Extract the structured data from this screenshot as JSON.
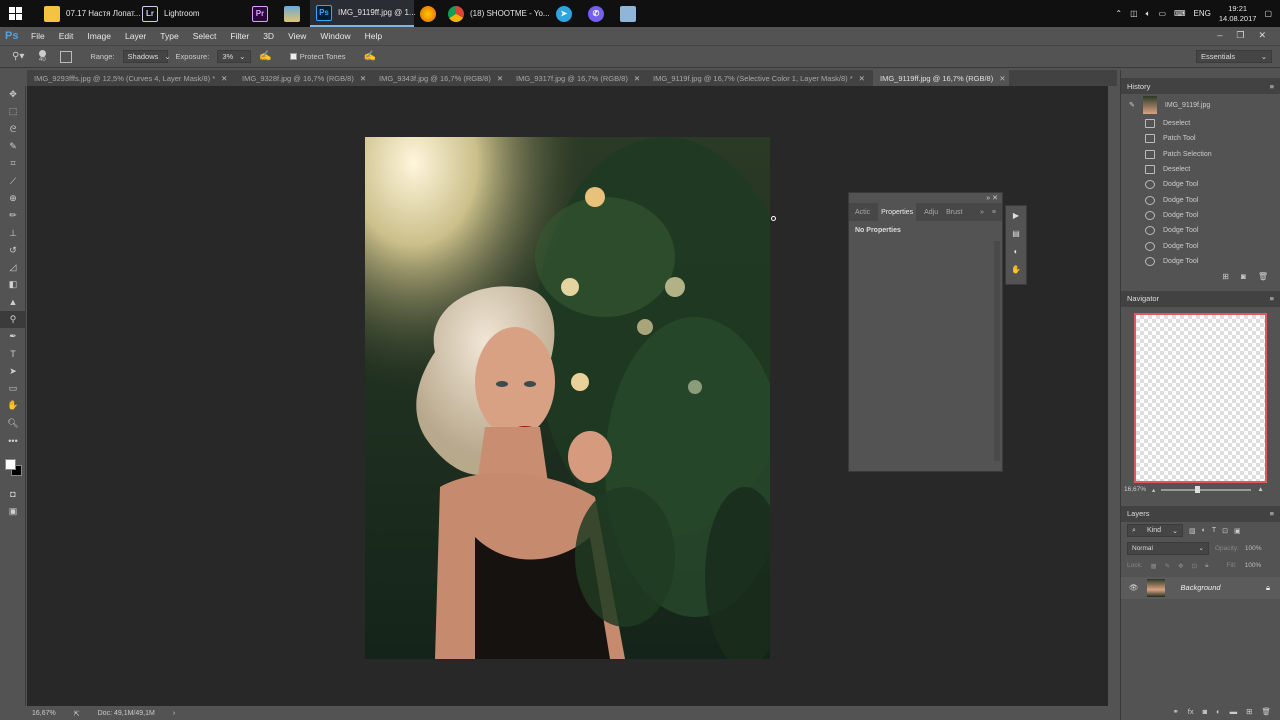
{
  "taskbar": {
    "items": [
      {
        "label": "07.17 Настя Лопат...",
        "icon": "folder-icon",
        "color": "#f5c342"
      },
      {
        "label": "Lightroom",
        "icon": "lightroom-icon",
        "color": "#31a8ff"
      },
      {
        "label": "",
        "icon": "premiere-icon",
        "color": "#9999ff"
      },
      {
        "label": "",
        "icon": "photos-icon",
        "color": "#5aa3d8"
      },
      {
        "label": "IMG_9119ff.jpg @ 1...",
        "icon": "photoshop-icon",
        "color": "#31a8ff"
      },
      {
        "label": "",
        "icon": "firefox-icon",
        "color": "#e66000"
      },
      {
        "label": "(18) SHOOTME - Yo...",
        "icon": "chrome-icon",
        "color": "#4caf50"
      },
      {
        "label": "",
        "icon": "telegram-icon",
        "color": "#2ca5e0"
      },
      {
        "label": "",
        "icon": "viber-icon",
        "color": "#7360f2"
      },
      {
        "label": "",
        "icon": "notepad-icon",
        "color": "#8fb6d8"
      }
    ],
    "lang": "ENG",
    "time": "19:21",
    "date": "14.08.2017"
  },
  "menu": [
    "File",
    "Edit",
    "Image",
    "Layer",
    "Type",
    "Select",
    "Filter",
    "3D",
    "View",
    "Window",
    "Help"
  ],
  "options": {
    "brush_size": "40",
    "range_label": "Range:",
    "range_value": "Shadows",
    "exposure_label": "Exposure:",
    "exposure_value": "3%",
    "protect_tones": "Protect Tones",
    "workspace": "Essentials"
  },
  "tabs": [
    {
      "label": "IMG_9293fffs.jpg @ 12,5% (Curves 4, Layer Mask/8) *",
      "active": false
    },
    {
      "label": "IMG_9328f.jpg @ 16,7% (RGB/8)",
      "active": false
    },
    {
      "label": "IMG_9343f.jpg @ 16,7% (RGB/8)",
      "active": false
    },
    {
      "label": "IMG_9317f.jpg @ 16,7% (RGB/8)",
      "active": false
    },
    {
      "label": "IMG_9119f.jpg @ 16,7% (Selective Color 1, Layer Mask/8) *",
      "active": false
    },
    {
      "label": "IMG_9119ff.jpg @ 16,7% (RGB/8)",
      "active": true
    }
  ],
  "tools": [
    "move-icon",
    "marquee-icon",
    "lasso-icon",
    "quick-select-icon",
    "crop-icon",
    "eyedropper-icon",
    "healing-icon",
    "brush-icon",
    "clone-stamp-icon",
    "history-brush-icon",
    "eraser-icon",
    "gradient-icon",
    "blur-icon",
    "dodge-icon",
    "pen-icon",
    "type-icon",
    "path-select-icon",
    "shape-icon",
    "hand-icon",
    "zoom-icon",
    "more-icon"
  ],
  "status": {
    "zoom": "16,67%",
    "doc": "Doc: 49,1M/49,1M"
  },
  "properties_panel": {
    "tabs": [
      "Actic",
      "Properties",
      "Adju",
      "Brust"
    ],
    "message": "No Properties"
  },
  "history": {
    "title": "History",
    "snapshot": "IMG_9119f.jpg",
    "items": [
      "Deselect",
      "Patch Tool",
      "Patch Selection",
      "Deselect",
      "Dodge Tool",
      "Dodge Tool",
      "Dodge Tool",
      "Dodge Tool",
      "Dodge Tool",
      "Dodge Tool"
    ]
  },
  "navigator": {
    "title": "Navigator",
    "zoom": "16,67%"
  },
  "layers": {
    "title": "Layers",
    "filter": "Kind",
    "blend_mode": "Normal",
    "opacity_label": "Opacity:",
    "opacity": "100%",
    "lock_label": "Lock:",
    "fill_label": "Fill:",
    "fill": "100%",
    "items": [
      {
        "name": "Background",
        "visible": true,
        "locked": true
      }
    ]
  }
}
